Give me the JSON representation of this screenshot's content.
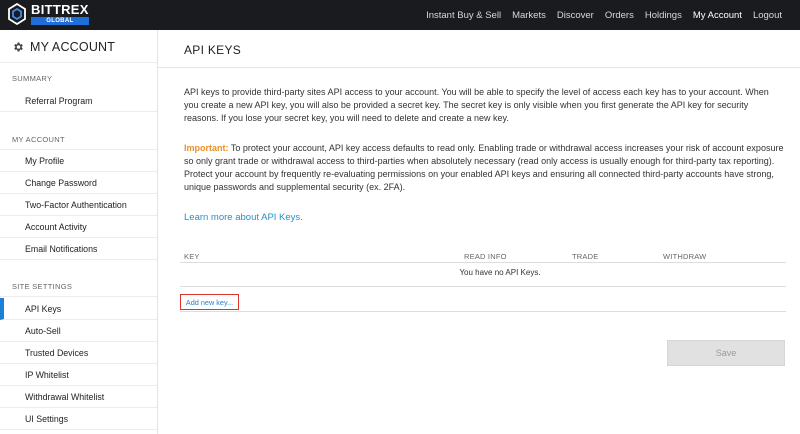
{
  "brand": {
    "name": "BITTREX",
    "sub": "GLOBAL"
  },
  "nav": {
    "items": [
      {
        "label": "Instant Buy & Sell"
      },
      {
        "label": "Markets"
      },
      {
        "label": "Discover"
      },
      {
        "label": "Orders"
      },
      {
        "label": "Holdings"
      },
      {
        "label": "My Account"
      },
      {
        "label": "Logout"
      }
    ],
    "active": "My Account"
  },
  "sidebar": {
    "title": "MY ACCOUNT",
    "title_icon": "gear-icon",
    "sections": [
      {
        "label": "SUMMARY",
        "items": [
          {
            "label": "Referral Program"
          }
        ]
      },
      {
        "label": "MY ACCOUNT",
        "items": [
          {
            "label": "My Profile"
          },
          {
            "label": "Change Password"
          },
          {
            "label": "Two-Factor Authentication"
          },
          {
            "label": "Account Activity"
          },
          {
            "label": "Email Notifications"
          }
        ]
      },
      {
        "label": "SITE SETTINGS",
        "items": [
          {
            "label": "API Keys"
          },
          {
            "label": "Auto-Sell"
          },
          {
            "label": "Trusted Devices"
          },
          {
            "label": "IP Whitelist"
          },
          {
            "label": "Withdrawal Whitelist"
          },
          {
            "label": "UI Settings"
          }
        ]
      }
    ],
    "active_item": "API Keys"
  },
  "main": {
    "title": "API KEYS",
    "intro": "API keys to provide third-party sites API access to your account. You will be able to specify the level of access each key has to your account. When you create a new API key, you will also be provided a secret key. The secret key is only visible when you first generate the API key for security reasons. If you lose your secret key, you will need to delete and create a new key.",
    "important_label": "Important:",
    "important_text": " To protect your account, API key access defaults to read only. Enabling trade or withdrawal access increases your risk of account exposure so only grant trade or withdrawal access to third-parties when absolutely necessary (read only access is usually enough for third-party tax reporting). Protect your account by frequently re-evaluating permissions on your enabled API keys and ensuring all connected third-party accounts have strong, unique passwords and supplemental security (ex. 2FA).",
    "learn_more": "Learn more about API Keys.",
    "table": {
      "columns": [
        "KEY",
        "READ INFO",
        "TRADE",
        "WITHDRAW"
      ],
      "empty_text": "You have no API Keys."
    },
    "add_key": "Add new key...",
    "save": "Save"
  },
  "colors": {
    "topbar": "#1a1b1f",
    "accent": "#1e7fd8",
    "important": "#e8912a",
    "link": "#2a8fc7",
    "highlight_box": "#d9332b"
  }
}
